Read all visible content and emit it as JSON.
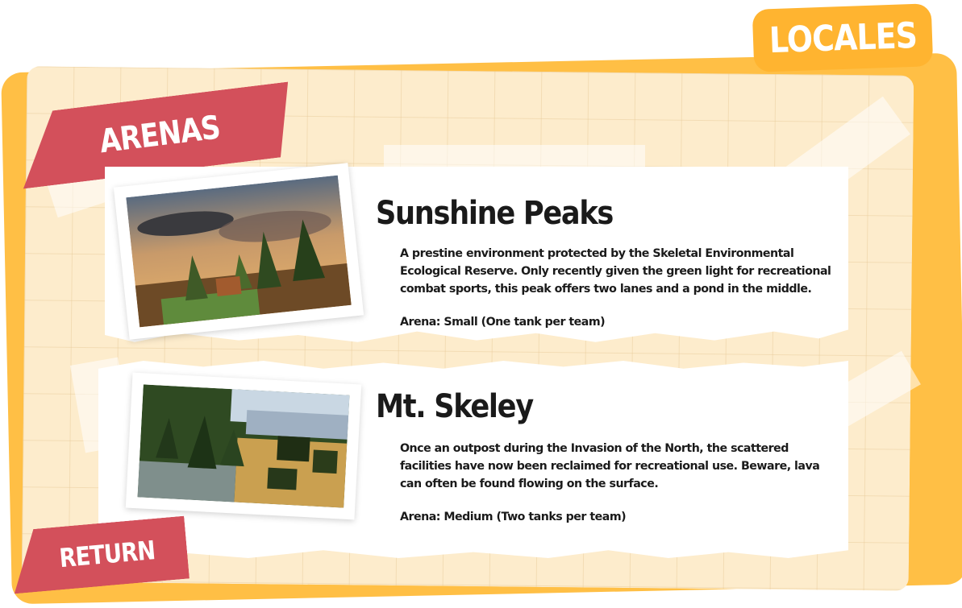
{
  "header": {
    "title": "LOCALES"
  },
  "section": {
    "label": "ARENAS"
  },
  "nav": {
    "return_label": "RETURN"
  },
  "arenas": [
    {
      "name": "Sunshine Peaks",
      "description": "A prestine environment protected by the Skeletal Environmental Ecological Reserve. Only recently given the green light for recreational combat sports, this peak offers two lanes and a pond in the middle.",
      "size": "Arena: Small (One tank per team)"
    },
    {
      "name": "Mt. Skeley",
      "description": "Once an outpost during the Invasion of the North, the scattered facilities have now been reclaimed for recreational use. Beware, lava can often be found flowing on the surface.",
      "size": "Arena: Medium (Two tanks per team)"
    }
  ],
  "colors": {
    "board_orange": "#ffbf45",
    "paper": "#fdeccc",
    "ribbon_red": "#d3505b",
    "tab_orange": "#ffb430"
  }
}
